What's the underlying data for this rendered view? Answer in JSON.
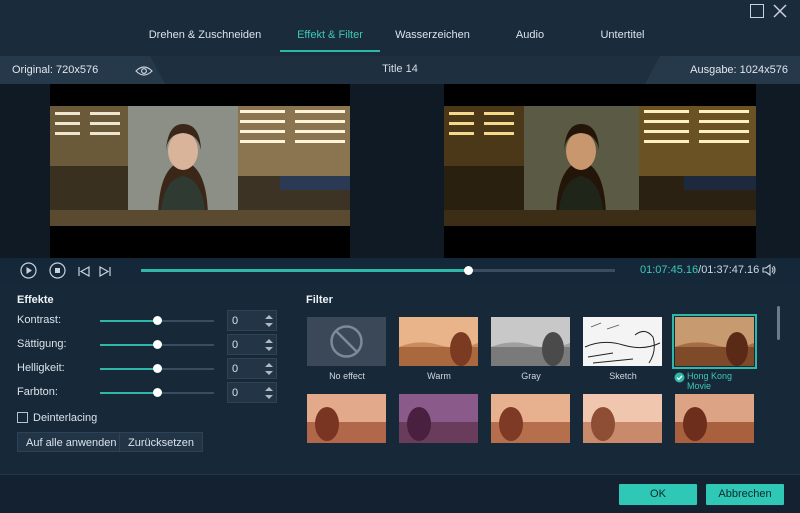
{
  "tabs": [
    {
      "label": "Drehen & Zuschneiden"
    },
    {
      "label": "Effekt & Filter"
    },
    {
      "label": "Wasserzeichen"
    },
    {
      "label": "Audio"
    },
    {
      "label": "Untertitel"
    }
  ],
  "active_tab": "Effekt & Filter",
  "info": {
    "original": "Original: 720x576",
    "title": "Title 14",
    "output": "Ausgabe: 1024x576"
  },
  "playback": {
    "current": "01:07:45.16",
    "separator": "/",
    "total": "01:37:47.16",
    "progress": 0.69
  },
  "effects": {
    "title": "Effekte",
    "rows": [
      {
        "label": "Kontrast:",
        "value": "0",
        "level": 0.5
      },
      {
        "label": "Sättigung:",
        "value": "0",
        "level": 0.5
      },
      {
        "label": "Helligkeit:",
        "value": "0",
        "level": 0.5
      },
      {
        "label": "Farbton:",
        "value": "0",
        "level": 0.5
      }
    ],
    "deinterlacing": "Deinterlacing",
    "apply_all": "Auf alle anwenden",
    "reset": "Zurücksetzen"
  },
  "filter": {
    "title": "Filter",
    "items": [
      {
        "label": "No effect"
      },
      {
        "label": "Warm"
      },
      {
        "label": "Gray"
      },
      {
        "label": "Sketch"
      },
      {
        "label": "Hong Kong Movie",
        "selected": true
      }
    ]
  },
  "footer": {
    "ok": "OK",
    "cancel": "Abbrechen"
  },
  "colors": {
    "accent": "#2fb8a8",
    "background": "#132131"
  }
}
